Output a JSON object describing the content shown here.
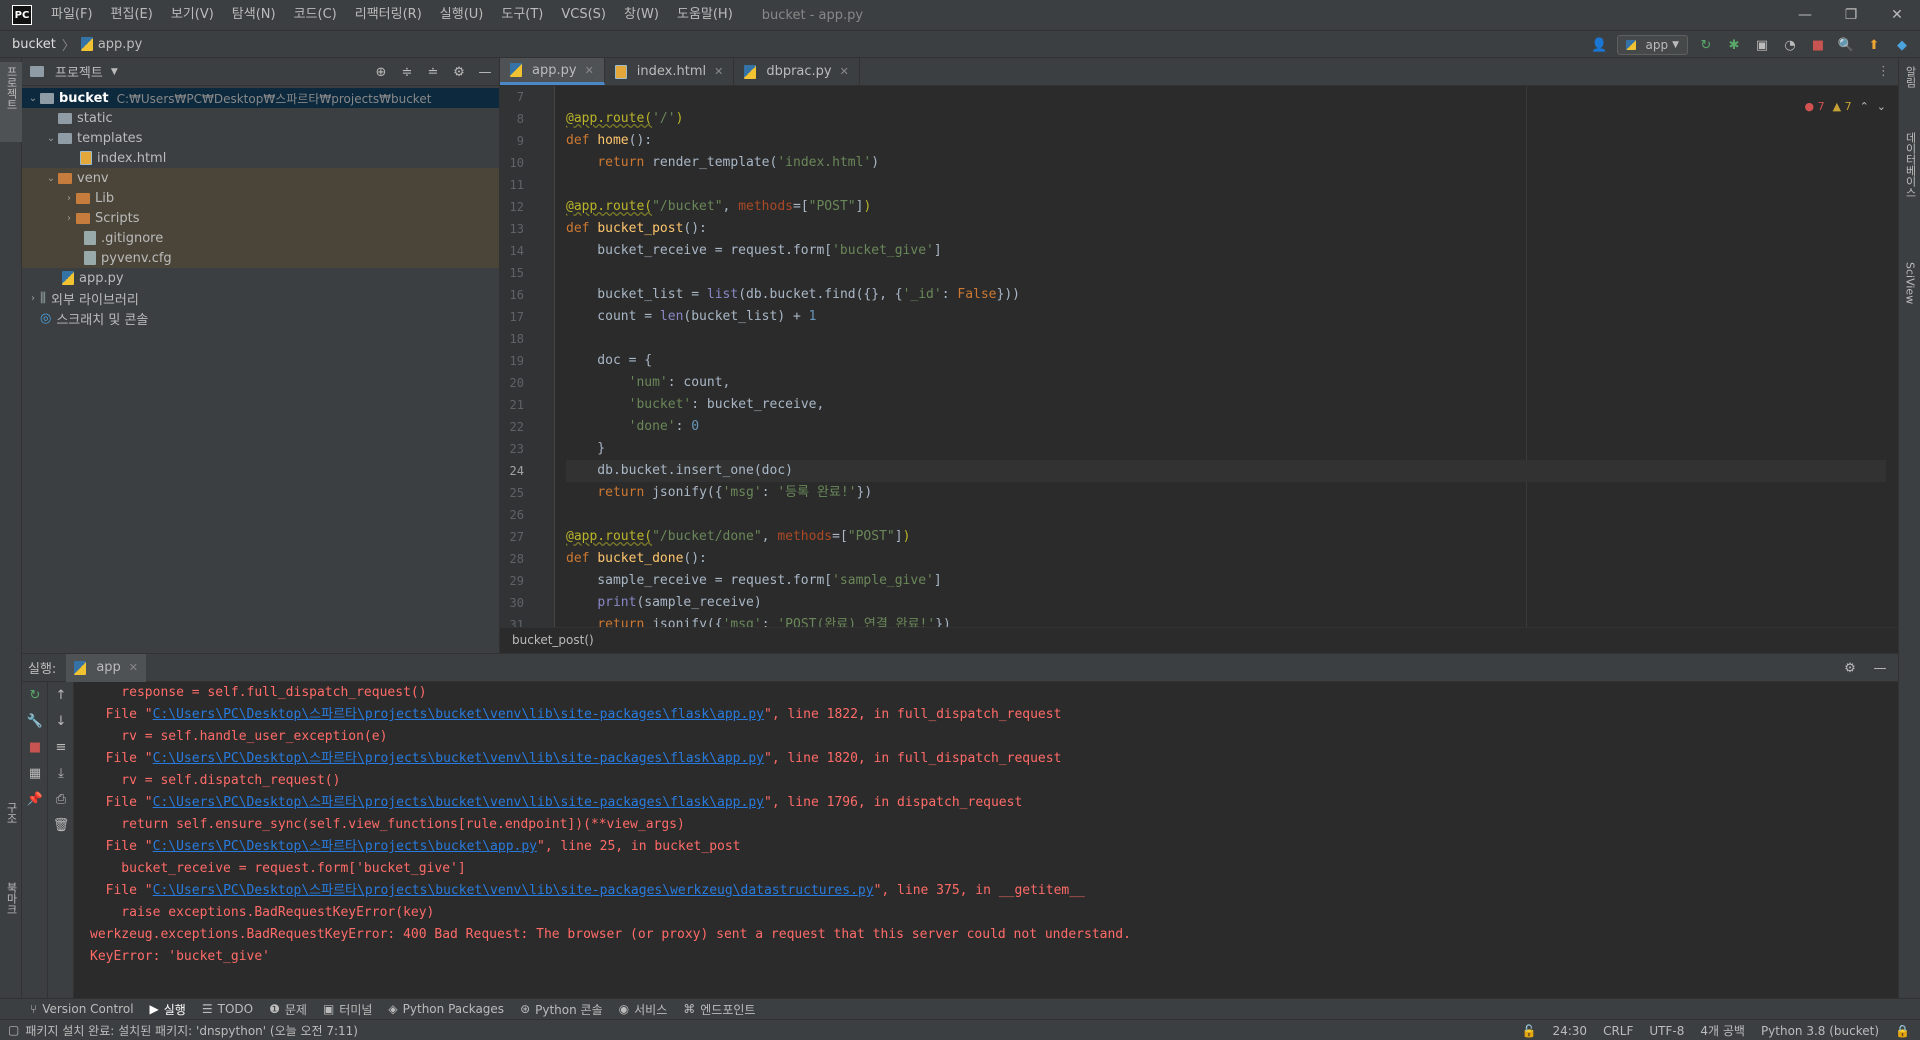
{
  "window": {
    "title": "bucket - app.py",
    "menu": [
      "파일(F)",
      "편집(E)",
      "보기(V)",
      "탐색(N)",
      "코드(C)",
      "리팩터링(R)",
      "실행(U)",
      "도구(T)",
      "VCS(S)",
      "창(W)",
      "도움말(H)"
    ],
    "logo": "PC"
  },
  "navbar": {
    "project": "bucket",
    "file": "app.py",
    "run_config": "app"
  },
  "left_strip": {
    "project_tab": "프로젝트",
    "structure_tab": "구조",
    "bookmarks_tab": "북마크"
  },
  "right_strip": {
    "notifications_tab": "알림",
    "database_tab": "데이터베이스",
    "sciview_tab": "SciView"
  },
  "project_panel": {
    "title": "프로젝트",
    "tree": [
      {
        "label": "bucket",
        "hint": "C:₩Users₩PC₩Desktop₩스파르타₩projects₩bucket"
      },
      {
        "label": "static"
      },
      {
        "label": "templates"
      },
      {
        "label": "index.html"
      },
      {
        "label": "venv"
      },
      {
        "label": "Lib"
      },
      {
        "label": "Scripts"
      },
      {
        "label": ".gitignore"
      },
      {
        "label": "pyvenv.cfg"
      },
      {
        "label": "app.py"
      },
      {
        "label": "외부 라이브러리"
      },
      {
        "label": "스크래치 및 콘솔"
      }
    ]
  },
  "editor": {
    "tabs": [
      {
        "label": "app.py"
      },
      {
        "label": "index.html"
      },
      {
        "label": "dbprac.py"
      }
    ],
    "errors": "7",
    "warnings": "7",
    "line_numbers": [
      "7",
      "8",
      "9",
      "10",
      "11",
      "12",
      "13",
      "14",
      "15",
      "16",
      "17",
      "18",
      "19",
      "20",
      "21",
      "22",
      "23",
      "24",
      "25",
      "26",
      "27",
      "28",
      "29",
      "30",
      "31"
    ],
    "breadcrumb": "bucket_post()"
  },
  "run_panel": {
    "label": "실행:",
    "tab": "app",
    "console": [
      "    response = self.full_dispatch_request()",
      "  File \"|C:\\Users\\PC\\Desktop\\스파르타\\projects\\bucket\\venv\\lib\\site-packages\\flask\\app.py|\", line 1822, in full_dispatch_request",
      "    rv = self.handle_user_exception(e)",
      "  File \"|C:\\Users\\PC\\Desktop\\스파르타\\projects\\bucket\\venv\\lib\\site-packages\\flask\\app.py|\", line 1820, in full_dispatch_request",
      "    rv = self.dispatch_request()",
      "  File \"|C:\\Users\\PC\\Desktop\\스파르타\\projects\\bucket\\venv\\lib\\site-packages\\flask\\app.py|\", line 1796, in dispatch_request",
      "    return self.ensure_sync(self.view_functions[rule.endpoint])(**view_args)",
      "  File \"|C:\\Users\\PC\\Desktop\\스파르타\\projects\\bucket\\app.py|\", line 25, in bucket_post",
      "    bucket_receive = request.form['bucket_give']",
      "  File \"|C:\\Users\\PC\\Desktop\\스파르타\\projects\\bucket\\venv\\lib\\site-packages\\werkzeug\\datastructures.py|\", line 375, in __getitem__",
      "    raise exceptions.BadRequestKeyError(key)",
      "werkzeug.exceptions.BadRequestKeyError: 400 Bad Request: The browser (or proxy) sent a request that this server could not understand.",
      "KeyError: 'bucket_give'"
    ]
  },
  "bottom_tabs": [
    {
      "label": "Version Control",
      "icon": "branch-icon"
    },
    {
      "label": "실행",
      "icon": "play-icon"
    },
    {
      "label": "TODO",
      "icon": "list-icon"
    },
    {
      "label": "문제",
      "icon": "warning-icon"
    },
    {
      "label": "터미널",
      "icon": "terminal-icon"
    },
    {
      "label": "Python Packages",
      "icon": "layers-icon"
    },
    {
      "label": "Python 콘솔",
      "icon": "python-icon"
    },
    {
      "label": "서비스",
      "icon": "services-icon"
    },
    {
      "label": "엔드포인트",
      "icon": "endpoints-icon"
    }
  ],
  "statusbar": {
    "message": "패키지 설치 완료: 설치된 패키지: 'dnspython' (오늘 오전 7:11)",
    "position": "24:30",
    "line_sep": "CRLF",
    "encoding": "UTF-8",
    "indent": "4개 공백",
    "interpreter": "Python 3.8 (bucket)"
  },
  "colors": {
    "accent": "#4a88c7",
    "error": "#ff6b68",
    "link": "#287bde"
  }
}
